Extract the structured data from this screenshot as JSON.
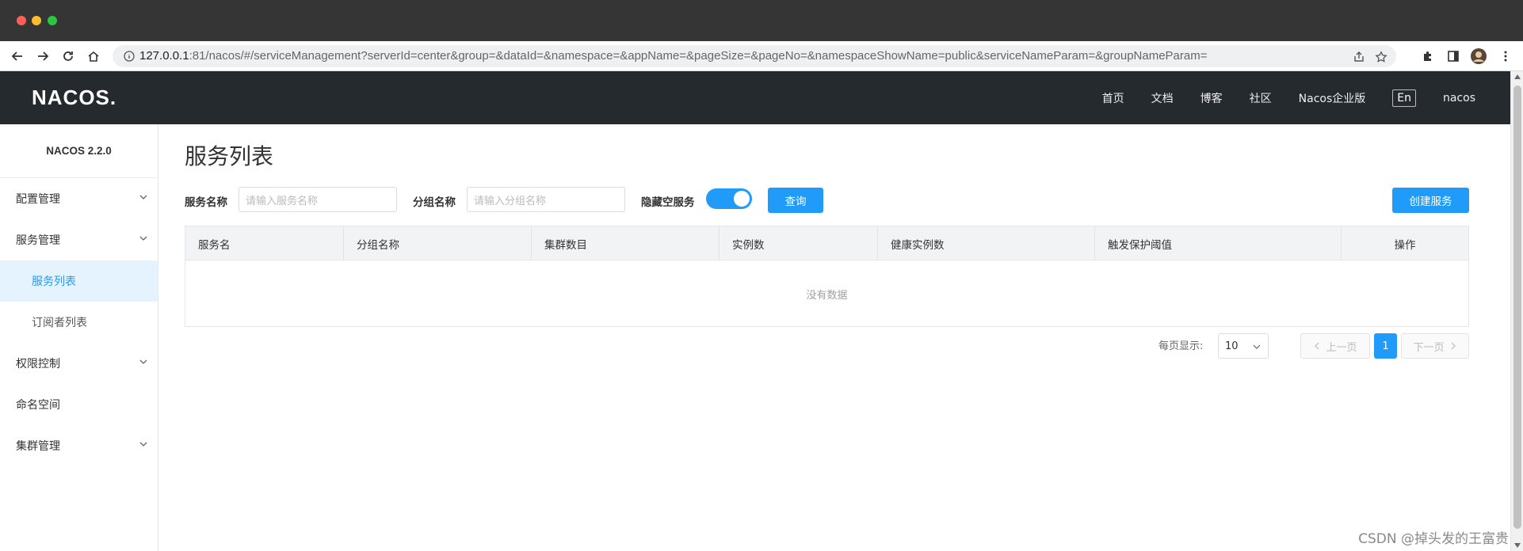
{
  "browser": {
    "url_host": "127.0.0.1",
    "url_rest": ":81/nacos/#/serviceManagement?serverId=center&group=&dataId=&namespace=&appName=&pageSize=&pageNo=&namespaceShowName=public&serviceNameParam=&groupNameParam="
  },
  "header": {
    "logo": "NACOS.",
    "nav": [
      "首页",
      "文档",
      "博客",
      "社区",
      "Nacos企业版"
    ],
    "lang": "En",
    "user": "nacos"
  },
  "sidebar": {
    "version": "NACOS 2.2.0",
    "items": [
      {
        "label": "配置管理",
        "expandable": true
      },
      {
        "label": "服务管理",
        "expandable": true
      },
      {
        "label": "服务列表",
        "sub": true,
        "active": true
      },
      {
        "label": "订阅者列表",
        "sub": true
      },
      {
        "label": "权限控制",
        "expandable": true
      },
      {
        "label": "命名空间"
      },
      {
        "label": "集群管理",
        "expandable": true
      }
    ]
  },
  "main": {
    "title": "服务列表",
    "filters": {
      "service_name_label": "服务名称",
      "service_name_placeholder": "请输入服务名称",
      "group_name_label": "分组名称",
      "group_name_placeholder": "请输入分组名称",
      "hide_empty_label": "隐藏空服务",
      "hide_empty_on": true,
      "query_button": "查询",
      "create_button": "创建服务"
    },
    "table": {
      "columns": [
        "服务名",
        "分组名称",
        "集群数目",
        "实例数",
        "健康实例数",
        "触发保护阈值",
        "操作"
      ],
      "empty_text": "没有数据"
    },
    "pagination": {
      "page_size_label": "每页显示:",
      "page_size": "10",
      "prev": "上一页",
      "current_page": "1",
      "next": "下一页"
    }
  },
  "watermark": "CSDN @掉头发的王富贵",
  "colors": {
    "accent": "#209bfa",
    "header_bg": "#252a2f",
    "active_menu_bg": "#e5f3fe"
  }
}
